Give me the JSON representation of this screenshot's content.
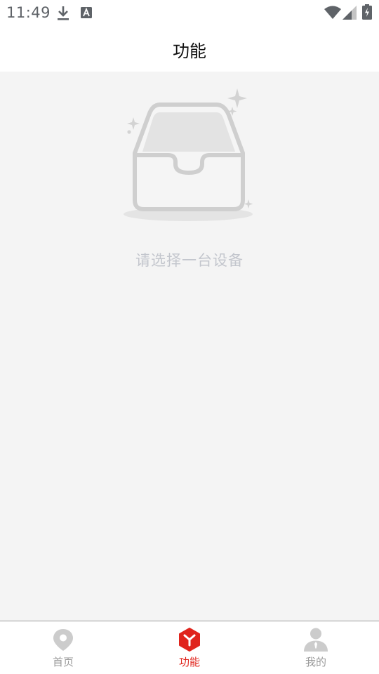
{
  "status_bar": {
    "time": "11:49",
    "icons": [
      "download-icon",
      "text-a-icon",
      "wifi-icon",
      "cell-signal-icon",
      "battery-charging-icon"
    ]
  },
  "header": {
    "title": "功能"
  },
  "empty_state": {
    "icon": "empty-box-icon",
    "message": "请选择一台设备"
  },
  "bottom_nav": {
    "active_color": "#e0241c",
    "inactive_color": "#9a9a9a",
    "items": [
      {
        "label": "首页",
        "icon": "location-pin-icon",
        "active": false
      },
      {
        "label": "功能",
        "icon": "function-hex-icon",
        "active": true
      },
      {
        "label": "我的",
        "icon": "user-icon",
        "active": false
      }
    ]
  }
}
